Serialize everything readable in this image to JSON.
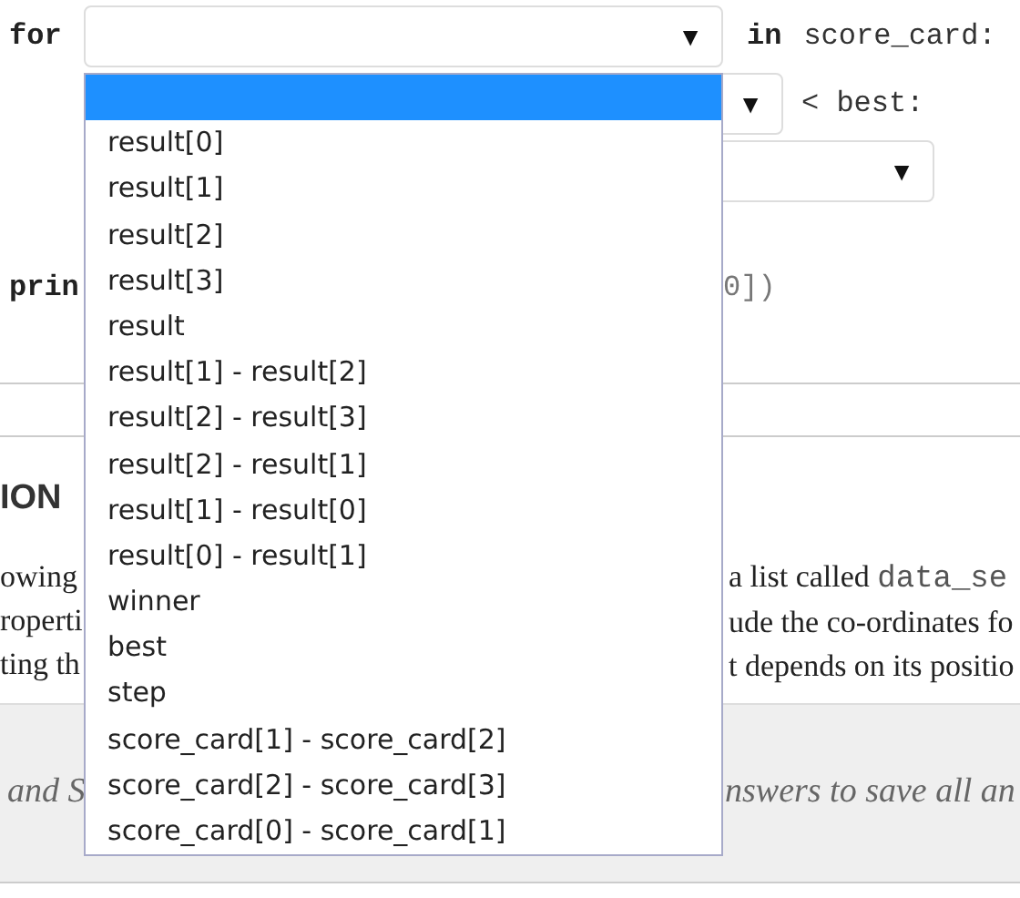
{
  "for_line": {
    "keyword": "for",
    "select_arrow": "▼",
    "in_keyword": "in",
    "iterable": "score_card:"
  },
  "if_line": {
    "select_arrow": "▼",
    "comparison": "< best:"
  },
  "assign_line": {
    "select_arrow": "▼"
  },
  "print_line": {
    "left": "prin",
    "right": "0])"
  },
  "section": {
    "heading": "ION",
    "paragraph_lines": [
      {
        "left": "owing",
        "right": "a list called ",
        "right_code": "data_se"
      },
      {
        "left": "roperti",
        "right": "ude the co-ordinates fo"
      },
      {
        "left": "ting th",
        "right": "t depends on its positio"
      }
    ]
  },
  "footer_note": {
    "left": "and S",
    "right": "nswers to save all an"
  },
  "dropdown": {
    "options": [
      {
        "selected": true
      },
      {
        "label": "result[0]",
        "selected": false
      },
      {
        "label": "result[1]",
        "selected": false
      },
      {
        "label": "result[2]",
        "selected": false
      },
      {
        "label": "result[3]",
        "selected": false
      },
      {
        "label": "result",
        "selected": false
      },
      {
        "label": "result[1] - result[2]",
        "selected": false
      },
      {
        "label": "result[2] - result[3]",
        "selected": false
      },
      {
        "label": "result[2] - result[1]",
        "selected": false
      },
      {
        "label": "result[1] - result[0]",
        "selected": false
      },
      {
        "label": "result[0] - result[1]",
        "selected": false
      },
      {
        "label": "winner",
        "selected": false
      },
      {
        "label": "best",
        "selected": false
      },
      {
        "label": "step",
        "selected": false
      },
      {
        "label": "score_card[1] - score_card[2]",
        "selected": false
      },
      {
        "label": "score_card[2] - score_card[3]",
        "selected": false
      },
      {
        "label": "score_card[0] - score_card[1]",
        "selected": false
      }
    ]
  }
}
